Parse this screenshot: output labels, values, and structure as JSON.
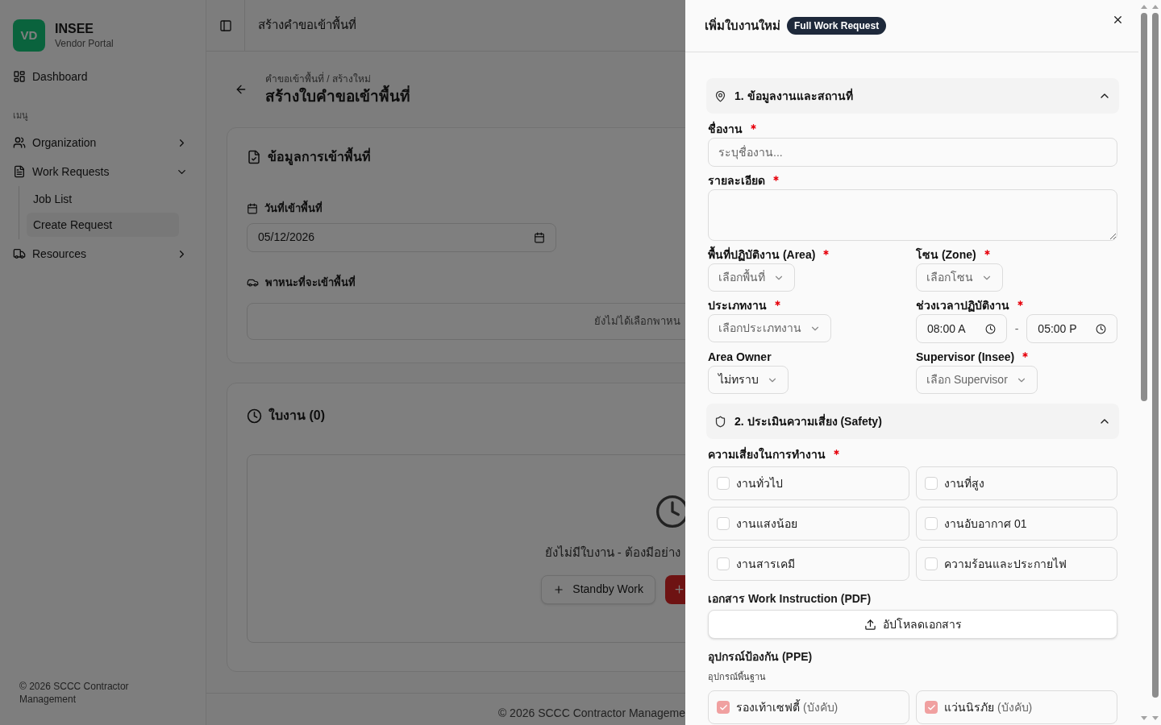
{
  "sidebar": {
    "logo": "VD",
    "brand": "INSEE",
    "subtitle": "Vendor Portal",
    "nav": [
      {
        "label": "Dashboard"
      }
    ],
    "section_label": "เมนู",
    "menu": [
      {
        "label": "Organization",
        "expanded": false
      },
      {
        "label": "Work Requests",
        "expanded": true,
        "children": [
          {
            "label": "Job List",
            "selected": false
          },
          {
            "label": "Create Request",
            "selected": true
          }
        ]
      },
      {
        "label": "Resources",
        "expanded": false
      }
    ],
    "footer": "© 2026 SCCC Contractor Management"
  },
  "topbar": {
    "title": "สร้างคำขอเข้าพื้นที่"
  },
  "page": {
    "breadcrumb": "คำขอเข้าพื้นที่ / สร้างใหม่",
    "title": "สร้างใบคำขอเข้าพื้นที่"
  },
  "entry_card": {
    "title": "ข้อมูลการเข้าพื้นที่",
    "date_label": "วันที่เข้าพื้นที่",
    "date_value": "05/12/2026",
    "vehicle_label": "พาหนะที่จะเข้าพื้นที่",
    "vehicle_empty": "ยังไม่ได้เลือกพาหน"
  },
  "jobs_card": {
    "title": "ใบงาน (0)",
    "empty_text": "ยังไม่มีใบงาน - ต้องมีอย่าง",
    "buttons": [
      {
        "kind": "outline",
        "label": "Standby Work"
      },
      {
        "kind": "primary"
      }
    ]
  },
  "page_footer": "© 2026 SCCC Contractor Manageme",
  "drawer": {
    "title": "เพิ่มใบงานใหม่",
    "badge": "Full Work Request",
    "section_1": {
      "title": "1. ข้อมูลงานและสถานที่",
      "expanded": true,
      "fields": [
        {
          "kind": "text",
          "label": "ชื่องาน",
          "required": true,
          "placeholder": "ระบุชื่องาน..."
        },
        {
          "kind": "textarea",
          "label": "รายละเอียด",
          "required": true
        },
        {
          "kind": "select",
          "label": "พื้นที่ปฏิบัติงาน (Area)",
          "required": true,
          "placeholder": "เลือกพื้นที่"
        },
        {
          "kind": "select",
          "label": "โซน (Zone)",
          "required": true,
          "placeholder": "เลือกโซน"
        },
        {
          "kind": "select",
          "label": "ประเภทงาน",
          "required": true,
          "placeholder": "เลือกประเภทงาน"
        },
        {
          "kind": "time_range",
          "label": "ช่วงเวลาปฏิบัติงาน",
          "required": true,
          "start": "08:00 A",
          "separator": "-",
          "end": "05:00 P"
        },
        {
          "kind": "select",
          "label": "Area Owner",
          "required": false,
          "value": "ไม่ทราบ"
        },
        {
          "kind": "select",
          "label": "Supervisor (Insee)",
          "required": true,
          "placeholder": "เลือก Supervisor"
        }
      ]
    },
    "section_2": {
      "title": "2. ประเมินความเสี่ยง (Safety)",
      "expanded": true,
      "risk": {
        "label": "ความเสี่ยงในการทำงาน",
        "required": true,
        "options": [
          {
            "label": "งานทั่วไป",
            "checked": false
          },
          {
            "label": "งานที่สูง",
            "checked": false
          },
          {
            "label": "งานแสงน้อย",
            "checked": false
          },
          {
            "label": "งานอับอากาศ 01",
            "checked": false
          },
          {
            "label": "งานสารเคมี",
            "checked": false
          },
          {
            "label": "ความร้อนและประกายไฟ",
            "checked": false
          }
        ]
      },
      "document": {
        "label": "เอกสาร Work Instruction (PDF)",
        "button": "อัปโหลดเอกสาร"
      },
      "ppe": {
        "label": "อุปกรณ์ป้องกัน (PPE)",
        "sublabel": "อุปกรณ์พื้นฐาน",
        "items": [
          {
            "label": "รองเท้าเซฟตี้",
            "note": "(บังคับ)",
            "checked": true
          },
          {
            "label": "แว่นนิรภัย",
            "note": "(บังคับ)",
            "checked": true
          }
        ]
      }
    }
  }
}
